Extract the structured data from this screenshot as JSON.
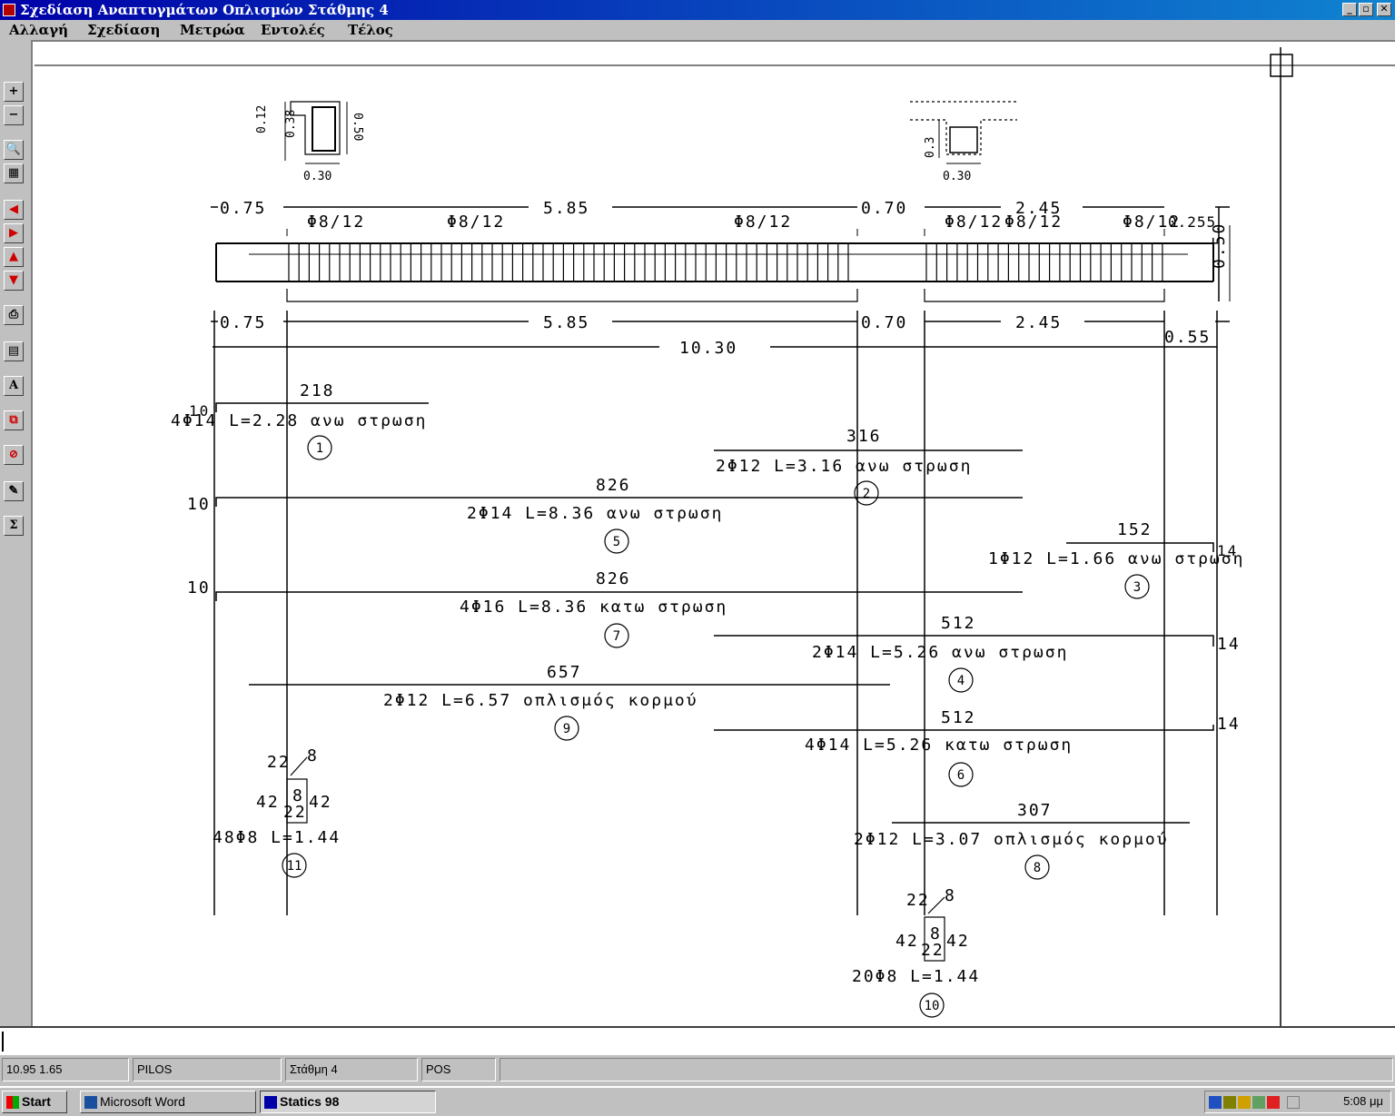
{
  "window": {
    "title": "Σχεδίαση Αναπτυγμάτων Οπλισμών Στάθμης 4",
    "min": "_",
    "max": "▫",
    "close": "✕"
  },
  "menu": [
    "Αλλαγή",
    "Σχεδίαση",
    "Μετρώα",
    "Εντολές",
    "Τέλος"
  ],
  "toolbar": [
    "+",
    "−",
    "🔍",
    "▦",
    "◀",
    "▶",
    "▲",
    "▼",
    "⎙",
    "▤",
    "A",
    "⧉",
    "⊘",
    "✎",
    "Σ"
  ],
  "drawing": {
    "section_left": {
      "h1": "0.12",
      "h2": "0.38",
      "h3": "0.50",
      "w": "0.30"
    },
    "section_right": {
      "h": "0.3",
      "w": "0.30"
    },
    "dims_top": [
      "0.75",
      "5.85",
      "0.70",
      "2.45"
    ],
    "stirrups": [
      "Φ8/12",
      "Φ8/12",
      "Φ8/12",
      "Φ8/12",
      "Φ8/12",
      "Φ8/12"
    ],
    "dim_extra": "0.255",
    "beam_height": "0.50",
    "dims_bottom": [
      "0.75",
      "5.85",
      "0.70",
      "2.45"
    ],
    "dim_end": "0.55",
    "total": "10.30",
    "bars": [
      {
        "len": "218",
        "desc": "4Φ14  L=2.28  ανω  στρωση",
        "num": "1",
        "hook": "10"
      },
      {
        "len": "316",
        "desc": "2Φ12  L=3.16  ανω  στρωση",
        "num": "2"
      },
      {
        "len": "826",
        "desc": "2Φ14  L=8.36  ανω  στρωση",
        "num": "5",
        "hook": "10"
      },
      {
        "len": "152",
        "desc": "1Φ12  L=1.66  ανω  στρωση",
        "num": "3",
        "hook": "14"
      },
      {
        "len": "826",
        "desc": "4Φ16  L=8.36  κατω  στρωση",
        "num": "7",
        "hook": "10"
      },
      {
        "len": "512",
        "desc": "2Φ14  L=5.26  ανω  στρωση",
        "num": "4",
        "hook": "14"
      },
      {
        "len": "657",
        "desc": "2Φ12  L=6.57  οπλισμός  κορμού",
        "num": "9"
      },
      {
        "len": "512",
        "desc": "4Φ14  L=5.26  κατω  στρωση",
        "num": "6",
        "hook": "14"
      },
      {
        "len": "307",
        "desc": "2Φ12  L=3.07  οπλισμός  κορμού",
        "num": "8"
      }
    ],
    "stirrup_left": {
      "a": "22",
      "b": "8",
      "c": "42",
      "d": "8",
      "e": "42",
      "f": "22",
      "desc": "48Φ8  L=1.44",
      "num": "11"
    },
    "stirrup_right": {
      "a": "22",
      "b": "8",
      "c": "42",
      "d": "8",
      "e": "42",
      "f": "22",
      "desc": "20Φ8  L=1.44",
      "num": "10"
    }
  },
  "status": {
    "coords": "10.95  1.65",
    "layer": "PILOS",
    "level": "Στάθμη 4",
    "mode": "POS"
  },
  "taskbar": {
    "start": "Start",
    "word": "Microsoft Word",
    "statics": "Statics 98",
    "clock": "5:08 μμ"
  }
}
